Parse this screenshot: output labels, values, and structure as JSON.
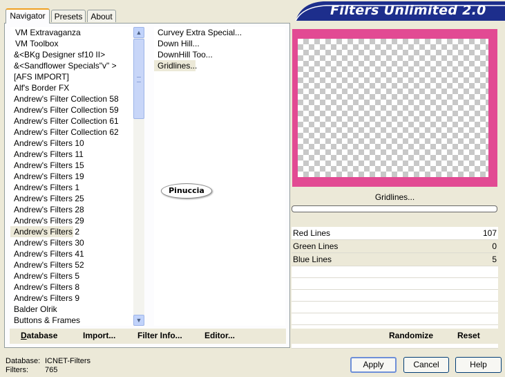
{
  "tabs": [
    {
      "label": "Navigator"
    },
    {
      "label": "Presets"
    },
    {
      "label": "About"
    }
  ],
  "banner": {
    "title": "Filters Unlimited 2.0"
  },
  "categories": [
    "VM Extravaganza",
    "VM Toolbox",
    "&<BKg Designer sf10 II>",
    "&<Sandflower Specials\"v\" >",
    "[AFS IMPORT]",
    "Alf's Border FX",
    "Andrew's Filter Collection 58",
    "Andrew's Filter Collection 59",
    "Andrew's Filter Collection 61",
    "Andrew's Filter Collection 62",
    "Andrew's Filters 10",
    "Andrew's Filters 11",
    "Andrew's Filters 15",
    "Andrew's Filters 19",
    "Andrew's Filters 1",
    "Andrew's Filters 25",
    "Andrew's Filters 28",
    "Andrew's Filters 29",
    "Andrew's Filters 2",
    "Andrew's Filters 30",
    "Andrew's Filters 41",
    "Andrew's Filters 52",
    "Andrew's Filters 5",
    "Andrew's Filters 8",
    "Andrew's Filters 9",
    "Balder Olrik",
    "Buttons & Frames"
  ],
  "filters": [
    "Curvey Extra Special...",
    "Down Hill...",
    "DownHill Too...",
    "Gridlines..."
  ],
  "watermark": "Pinuccia",
  "left_buttons": {
    "database": "Database",
    "import": "Import...",
    "filter_info": "Filter Info...",
    "editor": "Editor..."
  },
  "preview": {
    "label": "Gridlines...",
    "border_color": "#e24a93"
  },
  "params": [
    {
      "name": "Red Lines",
      "value": "107"
    },
    {
      "name": "Green Lines",
      "value": "0"
    },
    {
      "name": "Blue Lines",
      "value": "5"
    }
  ],
  "right_buttons": {
    "randomize": "Randomize",
    "reset": "Reset"
  },
  "status": {
    "database_label": "Database:",
    "database_value": "ICNET-Filters",
    "filters_label": "Filters:",
    "filters_value": "765"
  },
  "dialog_buttons": {
    "apply": "Apply",
    "cancel": "Cancel",
    "help": "Help"
  }
}
